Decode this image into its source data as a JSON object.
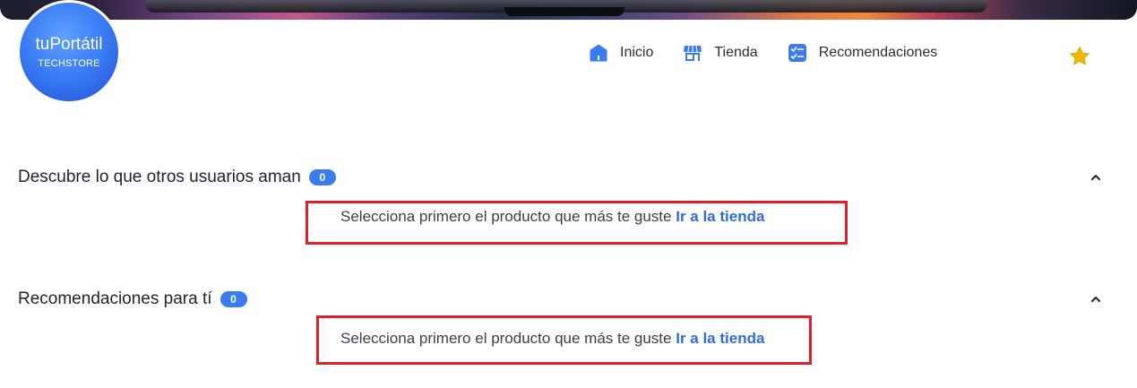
{
  "brand": {
    "name": "tuPortátil",
    "tagline": "TECHSTORE"
  },
  "nav": {
    "items": [
      {
        "label": "Inicio",
        "icon": "home-icon"
      },
      {
        "label": "Tienda",
        "icon": "store-icon"
      },
      {
        "label": "Recomendaciones",
        "icon": "checklist-icon"
      }
    ]
  },
  "favorites": {
    "icon": "star-icon",
    "color": "#f2b705"
  },
  "sections": [
    {
      "title": "Descubre lo que otros usuarios aman",
      "count": "0",
      "message": "Selecciona primero el producto que más te guste",
      "link": "Ir a la tienda"
    },
    {
      "title": "Recomendaciones para tí",
      "count": "0",
      "message": "Selecciona primero el producto que más te guste",
      "link": "Ir a la tienda"
    }
  ],
  "colors": {
    "accent": "#3a7bf0",
    "link": "#2e6be6",
    "highlight_box": "#e0202a",
    "star": "#f2b705"
  }
}
